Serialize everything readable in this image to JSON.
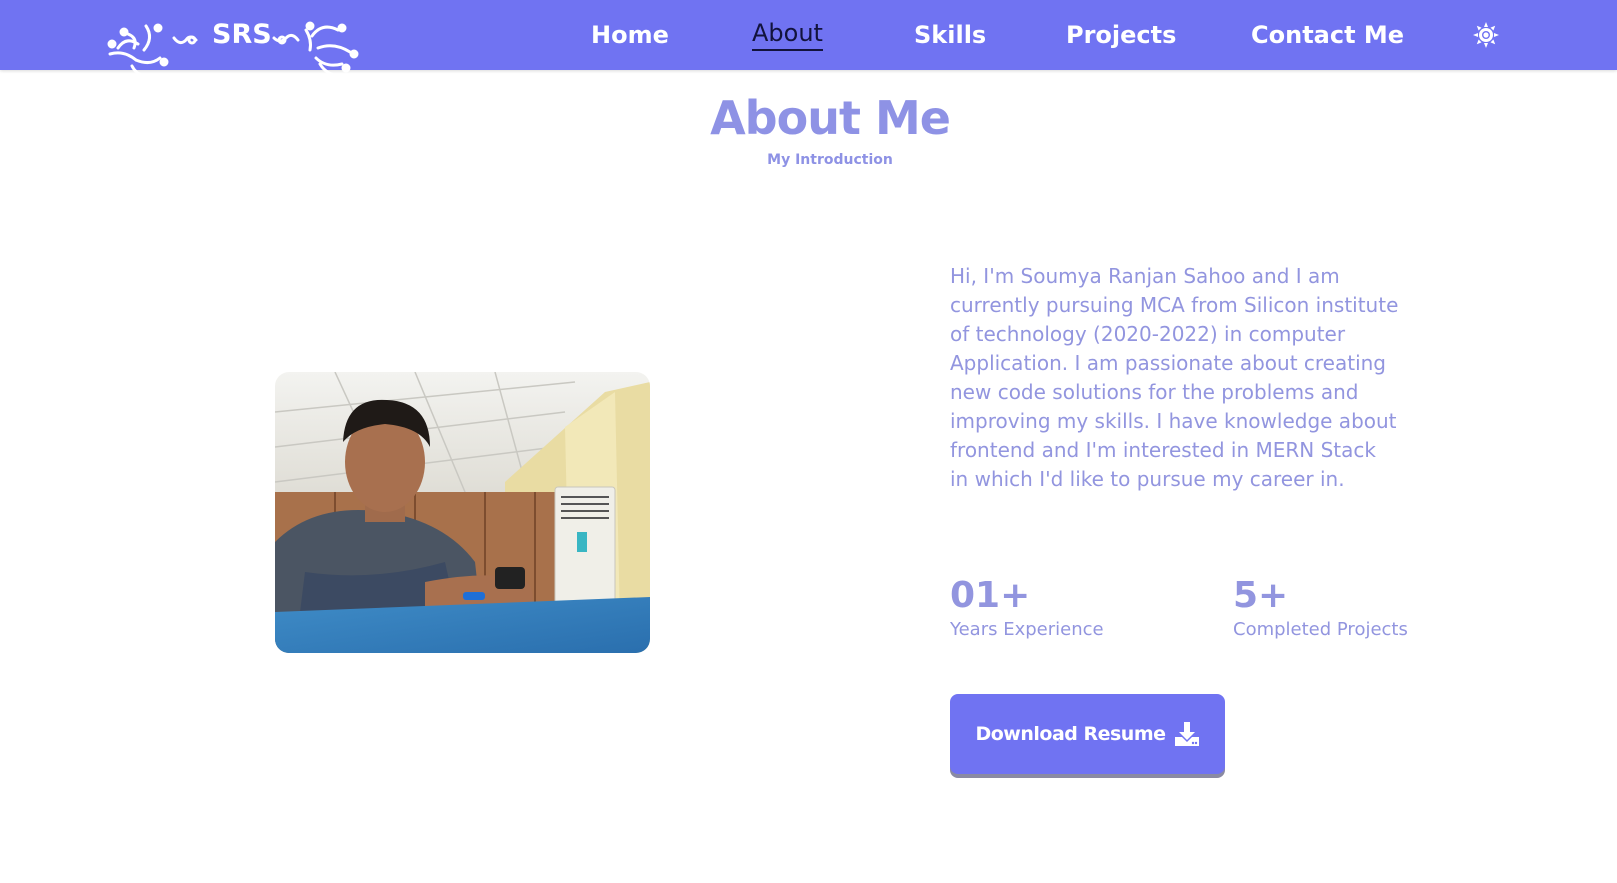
{
  "header": {
    "logo_text": "SRS",
    "nav": [
      {
        "label": "Home",
        "active": false
      },
      {
        "label": "About",
        "active": true
      },
      {
        "label": "Skills",
        "active": false
      },
      {
        "label": "Projects",
        "active": false
      },
      {
        "label": "Contact Me",
        "active": false
      }
    ],
    "theme_icon": "sun-icon"
  },
  "about": {
    "title": "About Me",
    "subtitle": "My Introduction",
    "description": "Hi, I'm Soumya Ranjan Sahoo and I am currently pursuing MCA from Silicon institute of technology (2020-2022) in computer Application. I am passionate about creating new code solutions for the problems and improving my skills. I have knowledge about frontend and I'm interested in MERN Stack in which I'd like to pursue my career in.",
    "stats": [
      {
        "number": "01+",
        "label": "Years Experience"
      },
      {
        "number": "5+",
        "label": "Completed Projects"
      }
    ],
    "download_label": "Download Resume",
    "download_icon": "download-icon",
    "photo_icon": "profile-photo"
  },
  "colors": {
    "brand": "#7073f2",
    "accent_text": "#9295df",
    "active_nav": "#12133d"
  }
}
